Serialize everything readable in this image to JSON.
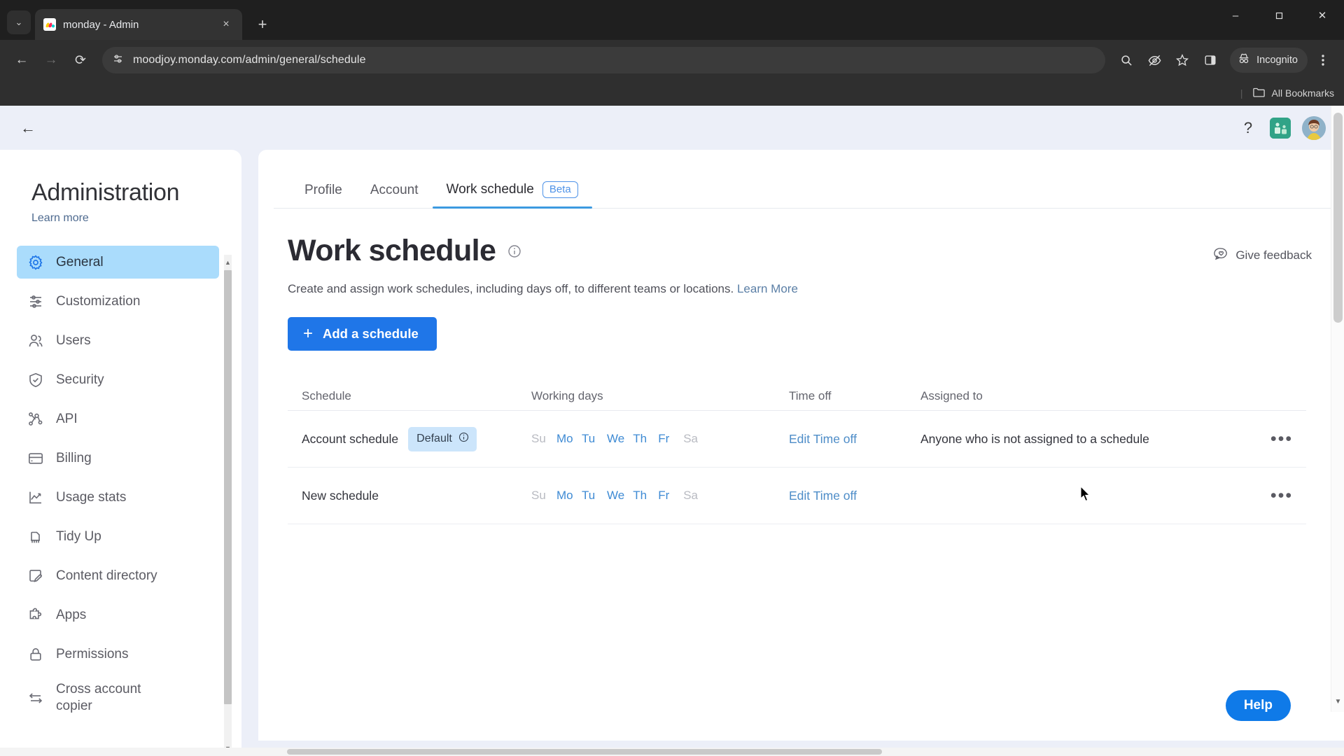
{
  "browser": {
    "tab": {
      "title": "monday - Admin",
      "favicon": "monday-logo-icon",
      "close": "×"
    },
    "new_tab_label": "+",
    "tab_list_caret": "⌄",
    "window_controls": {
      "minimize": "–",
      "maximize": "❐",
      "close": "✕"
    },
    "nav": {
      "back": "←",
      "forward": "→",
      "reload": "⟳"
    },
    "omnibox": {
      "url": "moodjoy.monday.com/admin/general/schedule",
      "site_info_icon": "page-settings-icon"
    },
    "toolbar_icons": [
      "search-icon",
      "hide-password-icon",
      "bookmark-star-icon",
      "side-panel-icon"
    ],
    "incognito": {
      "label": "Incognito",
      "icon": "incognito-hat-icon"
    },
    "menu_icon": "kebab-menu-icon",
    "bookmarks": {
      "separator": "|",
      "folder_icon": "folder-icon",
      "label": "All Bookmarks"
    }
  },
  "app": {
    "topbar": {
      "back_arrow": "←",
      "help_icon": "?",
      "workspace_icon": "workspace-tile-icon",
      "avatar_icon": "user-avatar"
    },
    "sidebar": {
      "title": "Administration",
      "learn_more": "Learn more",
      "items": [
        {
          "label": "General",
          "icon": "gear-icon",
          "active": true
        },
        {
          "label": "Customization",
          "icon": "sliders-icon",
          "active": false
        },
        {
          "label": "Users",
          "icon": "users-icon",
          "active": false
        },
        {
          "label": "Security",
          "icon": "shield-check-icon",
          "active": false
        },
        {
          "label": "API",
          "icon": "nodes-icon",
          "active": false
        },
        {
          "label": "Billing",
          "icon": "credit-card-icon",
          "active": false
        },
        {
          "label": "Usage stats",
          "icon": "line-chart-icon",
          "active": false
        },
        {
          "label": "Tidy Up",
          "icon": "broom-icon",
          "active": false
        },
        {
          "label": "Content directory",
          "icon": "edit-doc-icon",
          "active": false
        },
        {
          "label": "Apps",
          "icon": "puzzle-icon",
          "active": false
        },
        {
          "label": "Permissions",
          "icon": "lock-icon",
          "active": false
        },
        {
          "label": "Cross account copier",
          "icon": "transfer-arrows-icon",
          "active": false
        }
      ]
    },
    "tabs": [
      {
        "label": "Profile",
        "active": false,
        "badge": null
      },
      {
        "label": "Account",
        "active": false,
        "badge": null
      },
      {
        "label": "Work schedule",
        "active": true,
        "badge": "Beta"
      }
    ],
    "page": {
      "title": "Work schedule",
      "info_icon": "info-icon",
      "give_feedback": {
        "label": "Give feedback",
        "icon": "feedback-bubble-icon"
      },
      "subtitle": "Create and assign work schedules, including days off, to different teams or locations.",
      "subtitle_link": "Learn More",
      "add_button": {
        "label": "Add a schedule",
        "plus": "+"
      },
      "help_button": "Help"
    },
    "table": {
      "columns": [
        "Schedule",
        "Working days",
        "Time off",
        "Assigned to"
      ],
      "menu_glyph": "•••",
      "rows": [
        {
          "schedule": "Account schedule",
          "badge": {
            "label": "Default",
            "icon": "info-icon"
          },
          "days": [
            {
              "label": "Su",
              "on": false
            },
            {
              "label": "Mo",
              "on": true
            },
            {
              "label": "Tu",
              "on": true
            },
            {
              "label": "We",
              "on": true
            },
            {
              "label": "Th",
              "on": true
            },
            {
              "label": "Fr",
              "on": true
            },
            {
              "label": "Sa",
              "on": false
            }
          ],
          "time_off": "Edit Time off",
          "assigned_to": "Anyone who is not assigned to a schedule"
        },
        {
          "schedule": "New schedule",
          "badge": null,
          "days": [
            {
              "label": "Su",
              "on": false
            },
            {
              "label": "Mo",
              "on": true
            },
            {
              "label": "Tu",
              "on": true
            },
            {
              "label": "We",
              "on": true
            },
            {
              "label": "Th",
              "on": true
            },
            {
              "label": "Fr",
              "on": true
            },
            {
              "label": "Sa",
              "on": false
            }
          ],
          "time_off": "Edit Time off",
          "assigned_to": ""
        }
      ]
    }
  },
  "colors": {
    "accent_blue": "#1f76e8",
    "link_blue": "#4e8dc8",
    "active_nav": "#aadcfc",
    "badge_blue": "#cce5fb",
    "tab_underline": "#3c9ae0"
  }
}
